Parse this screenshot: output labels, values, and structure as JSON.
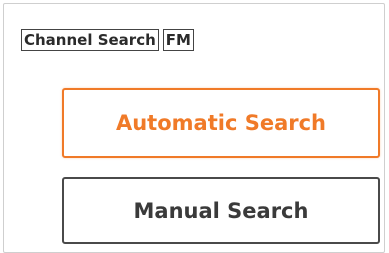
{
  "header": {
    "title": "Channel Search",
    "band": "FM"
  },
  "buttons": {
    "automatic_label": "Automatic Search",
    "manual_label": "Manual Search"
  },
  "colors": {
    "accent": "#f07a28",
    "text": "#3a3a3a",
    "border": "#4a4a4a"
  }
}
